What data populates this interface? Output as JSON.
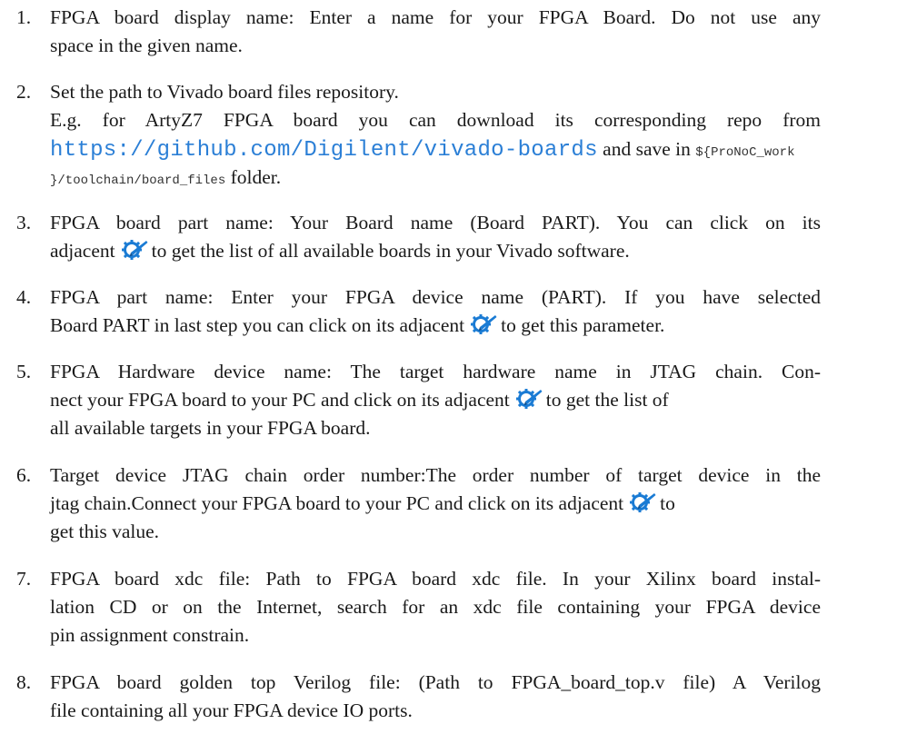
{
  "items": [
    {
      "num": "1.",
      "l1": "FPGA board display name: Enter a name for your FPGA Board. Do not use any",
      "l2": "space in the given name."
    },
    {
      "num": "2.",
      "l1": "Set the path to Vivado board files repository.",
      "l2": "E.g. for ArtyZ7 FPGA board you can download its corresponding repo from",
      "link": "https://github.com/Digilent/vivado-boards",
      "l3_mid": " and save in ",
      "code1": "${ProNoC_work",
      "code2": "}/toolchain/board_files",
      "l4_tail": " folder."
    },
    {
      "num": "3.",
      "l1": "FPGA board part name: Your Board name (Board PART). You can click on its",
      "l2a": "adjacent",
      "l2b": "to get the list of all available boards in your Vivado software."
    },
    {
      "num": "4.",
      "l1": "FPGA part name: Enter your FPGA device name (PART). If you have selected",
      "l2a": "Board PART in last step you can click on its adjacent",
      "l2b": "to get this parameter."
    },
    {
      "num": "5.",
      "l1": "FPGA Hardware device name: The target hardware name in JTAG chain. Con-",
      "l2a": "nect your FPGA board to your PC and click on its adjacent",
      "l2b": "to get the list of",
      "l3": "all available targets in your FPGA board."
    },
    {
      "num": "6.",
      "l1": "Target device JTAG chain order number:The order number of target device in the",
      "l2a": "jtag chain.Connect your FPGA board to your PC and click on its adjacent",
      "l2b": "to",
      "l3": "get this value."
    },
    {
      "num": "7.",
      "l1": "FPGA board xdc file: Path to FPGA board xdc file. In your Xilinx board instal-",
      "l2": "lation CD or on the Internet, search for an xdc file containing your FPGA device",
      "l3": "pin assignment constrain."
    },
    {
      "num": "8.",
      "l1": "FPGA board golden top Verilog file: (Path to FPGA_board_top.v file) A Verilog",
      "l2": "file containing all your FPGA device IO ports."
    }
  ],
  "icon_name": "configure-icon",
  "colors": {
    "link": "#2b7fd6",
    "icon": "#1a7bd4"
  }
}
